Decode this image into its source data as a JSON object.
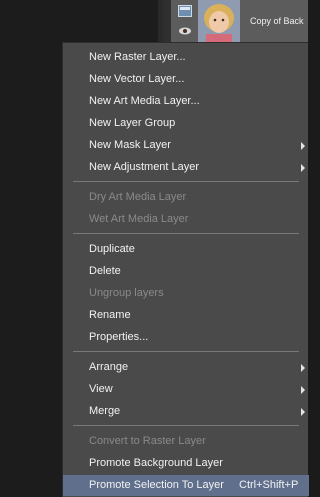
{
  "layers_panel": {
    "layer_name": "Copy of Back"
  },
  "menu": {
    "items": [
      {
        "label": "New Raster Layer...",
        "disabled": false,
        "submenu": false
      },
      {
        "label": "New Vector Layer...",
        "disabled": false,
        "submenu": false
      },
      {
        "label": "New Art Media Layer...",
        "disabled": false,
        "submenu": false
      },
      {
        "label": "New Layer Group",
        "disabled": false,
        "submenu": false
      },
      {
        "label": "New Mask Layer",
        "disabled": false,
        "submenu": true
      },
      {
        "label": "New Adjustment Layer",
        "disabled": false,
        "submenu": true
      },
      {
        "label": "Dry Art Media Layer",
        "disabled": true,
        "submenu": false
      },
      {
        "label": "Wet Art Media Layer",
        "disabled": true,
        "submenu": false
      },
      {
        "label": "Duplicate",
        "disabled": false,
        "submenu": false
      },
      {
        "label": "Delete",
        "disabled": false,
        "submenu": false
      },
      {
        "label": "Ungroup layers",
        "disabled": true,
        "submenu": false
      },
      {
        "label": "Rename",
        "disabled": false,
        "submenu": false
      },
      {
        "label": "Properties...",
        "disabled": false,
        "submenu": false
      },
      {
        "label": "Arrange",
        "disabled": false,
        "submenu": true
      },
      {
        "label": "View",
        "disabled": false,
        "submenu": true
      },
      {
        "label": "Merge",
        "disabled": false,
        "submenu": true
      },
      {
        "label": "Convert to Raster Layer",
        "disabled": true,
        "submenu": false
      },
      {
        "label": "Promote Background Layer",
        "disabled": false,
        "submenu": false
      },
      {
        "label": "Promote Selection To Layer",
        "disabled": false,
        "submenu": false,
        "highlighted": true,
        "shortcut": "Ctrl+Shift+P"
      }
    ]
  },
  "colors": {
    "menu_bg": "#4a4a4a",
    "highlight": "#5f6f8c",
    "disabled_text": "#8a8a8a"
  }
}
